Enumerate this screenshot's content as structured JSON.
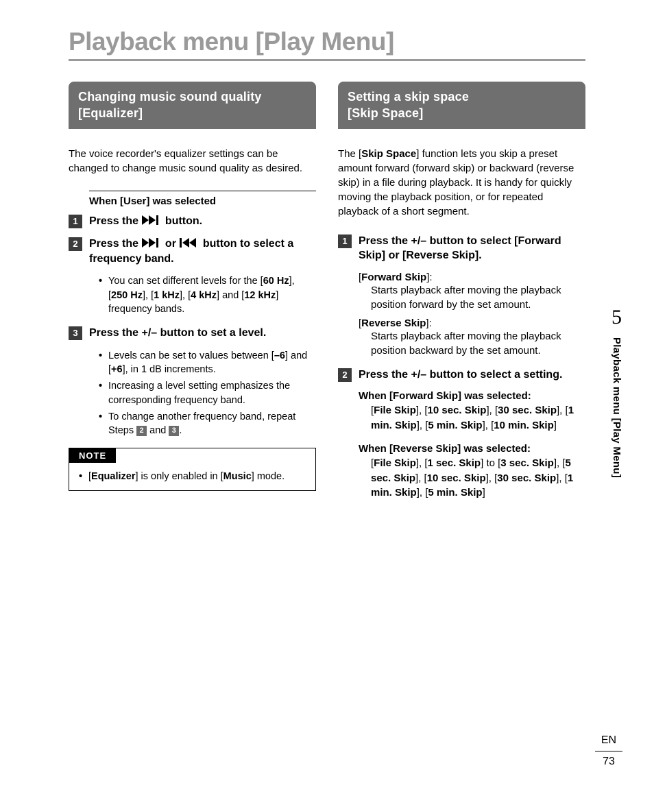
{
  "page_title": "Playback menu [Play Menu]",
  "left": {
    "header_l1": "Changing music sound quality",
    "header_l2": "[Equalizer]",
    "intro": "The voice recorder's equalizer settings can be changed to change music sound quality as desired.",
    "when_user": {
      "pre": "When [",
      "bold": "User",
      "post": "] was selected"
    },
    "step1": {
      "pre": "Press the ",
      "post": " button."
    },
    "step2": {
      "pre": "Press the ",
      "mid": " or ",
      "post": " button to select a frequency band."
    },
    "step2_bullet": {
      "pre": "You can set different levels for the [",
      "b1": "60 Hz",
      "s1": "], [",
      "b2": "250 Hz",
      "s2": "], [",
      "b3": "1 kHz",
      "s3": "], [",
      "b4": "4 kHz",
      "s4": "] and [",
      "b5": "12 kHz",
      "post": "] frequency bands."
    },
    "step3": "Press the +/– button to set a level.",
    "step3_bullets": {
      "a_pre": "Levels can be set to values between [",
      "a_b1": "–6",
      "a_mid": "] and [",
      "a_b2": "+6",
      "a_post": "], in 1 dB increments.",
      "b": "Increasing a level setting emphasizes the corresponding frequency band.",
      "c_pre": "To change another frequency band, repeat Steps ",
      "c_mid": " and ",
      "c_post": "."
    },
    "note_label": "NOTE",
    "note": {
      "pre": "[",
      "b1": "Equalizer",
      "mid": "] is only enabled in [",
      "b2": "Music",
      "post": "] mode."
    }
  },
  "right": {
    "header_l1": "Setting a skip space",
    "header_l2": "[Skip Space]",
    "intro": {
      "pre": "The [",
      "b": "Skip Space",
      "post": "] function lets you skip a preset amount forward (forward skip) or backward (reverse skip) in a file during playback. It is handy for quickly moving the playback position, or for repeated playback of a short segment."
    },
    "step1": {
      "pre": "Press the +/– button to select [",
      "b1": "Forward Skip",
      "mid": "] or [",
      "b2": "Reverse Skip",
      "post": "]."
    },
    "def_fwd_term": {
      "pre": "[",
      "b": "Forward Skip",
      "post": "]:"
    },
    "def_fwd_body": "Starts playback after moving the playback position forward by the set amount.",
    "def_rev_term": {
      "pre": "[",
      "b": "Reverse Skip",
      "post": "]:"
    },
    "def_rev_body": "Starts playback after moving the playback position backward by the set amount.",
    "step2": "Press the +/– button to select a setting.",
    "fwd_head": {
      "pre": "When [",
      "b": "Forward Skip",
      "post": "] was selected:"
    },
    "fwd_opts": {
      "o1": "File Skip",
      "o2": "10 sec. Skip",
      "o3": "30 sec. Skip",
      "o4": "1 min. Skip",
      "o5": "5 min. Skip",
      "o6": "10 min. Skip"
    },
    "rev_head": {
      "pre": "When [",
      "b": "Reverse Skip",
      "post": "] was selected:"
    },
    "rev_opts": {
      "o1": "File Skip",
      "o2": "1 sec. Skip",
      "to": "to",
      "o3": "3 sec. Skip",
      "o4": "5 sec. Skip",
      "o5": "10 sec. Skip",
      "o6": "30 sec. Skip",
      "o7": "1 min. Skip",
      "o8": "5 min. Skip"
    }
  },
  "side": {
    "chapter": "5",
    "label": "Playback menu [Play Menu]"
  },
  "footer": {
    "lang": "EN",
    "page": "73"
  },
  "nums": {
    "n1": "1",
    "n2": "2",
    "n3": "3"
  }
}
